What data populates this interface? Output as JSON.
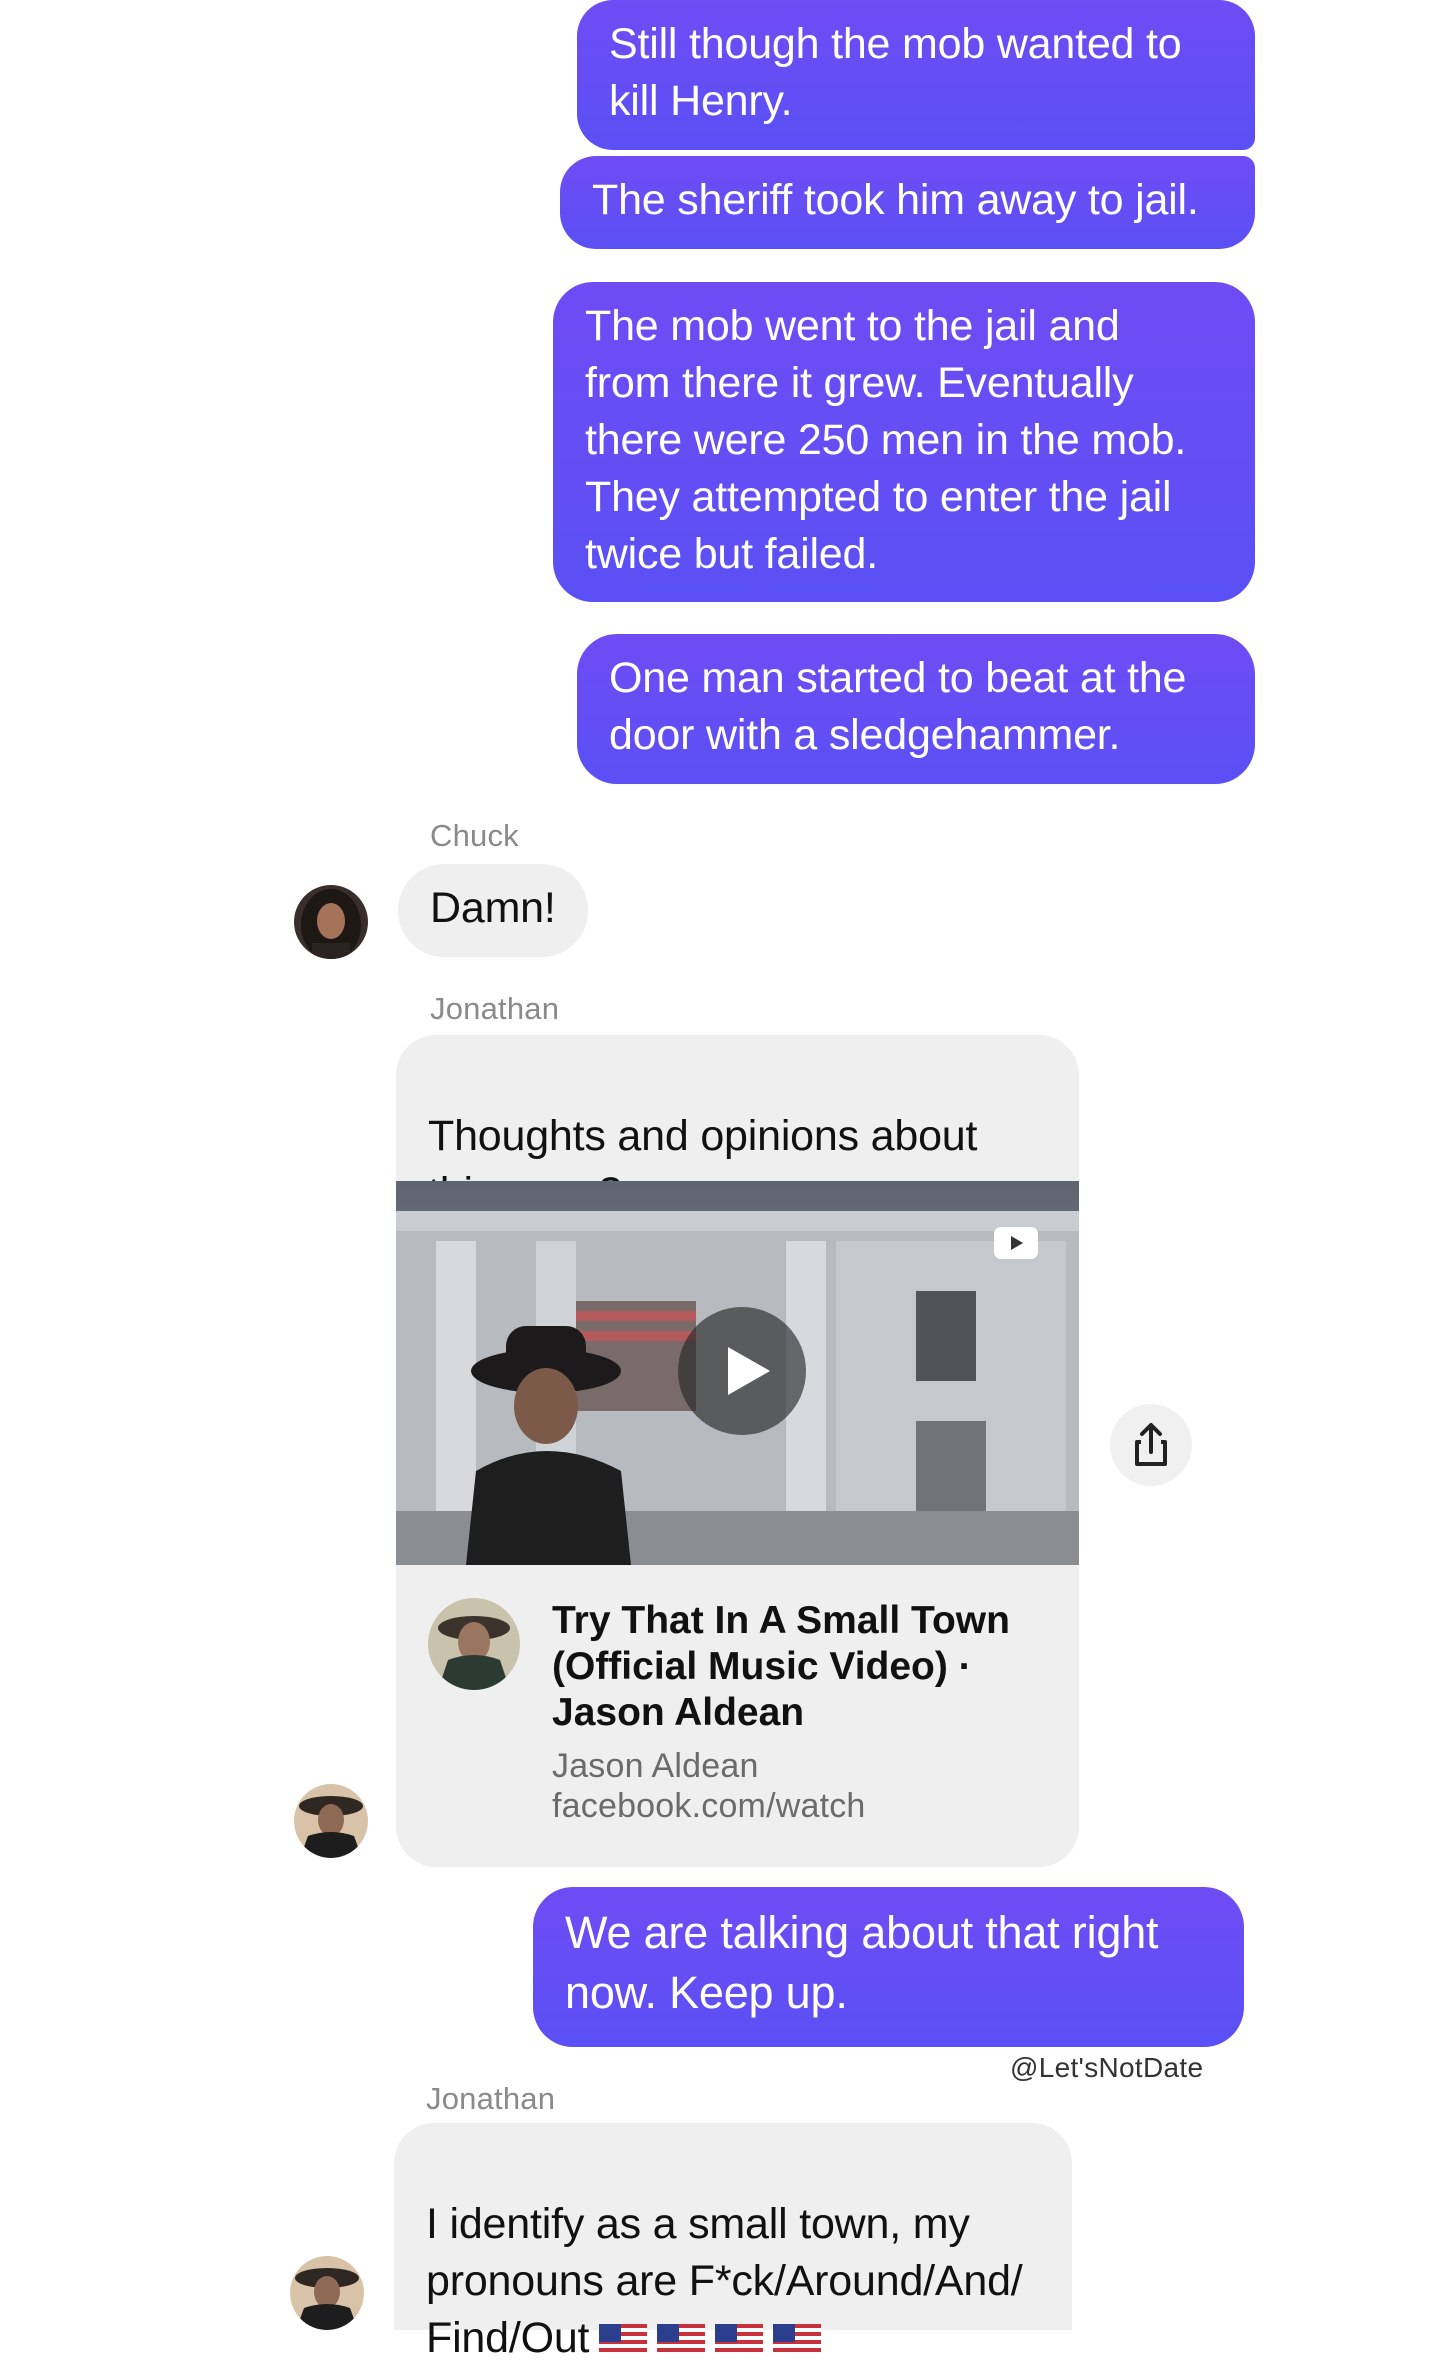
{
  "messages": {
    "out1": "Still though the mob wanted to\nkill Henry.",
    "out2": "The sheriff took him away to jail.",
    "out3": "The mob went to the jail and\nfrom there it grew. Eventually\nthere were 250 men in the mob.\nThey attempted to enter the jail\ntwice but failed.",
    "out4": "One man started to beat at the\ndoor with a sledgehammer.",
    "chuck_name": "Chuck",
    "chuck_msg": "Damn!",
    "jonathan_name_1": "Jonathan",
    "jonathan_msg_1": "Thoughts and opinions about\nthis song?",
    "link_title": "Try That In A Small Town\n(Official Music Video) ·\nJason Aldean",
    "link_author": "Jason Aldean",
    "link_domain": "facebook.com/watch",
    "out5": "We are talking about that right\nnow. Keep up.",
    "watermark": "@Let'sNotDate",
    "jonathan_name_2": "Jonathan",
    "jonathan_msg_2": "I identify as a small town, my\npronouns are F*ck/Around/And/\nFind/Out"
  },
  "icons": [
    "play-icon",
    "video-platform-icon",
    "share-icon",
    "us-flag-icon"
  ],
  "colors": {
    "outgoing_bubble": "#6150f5",
    "incoming_bubble": "#efefef",
    "sender_name": "#8a8a8a"
  }
}
